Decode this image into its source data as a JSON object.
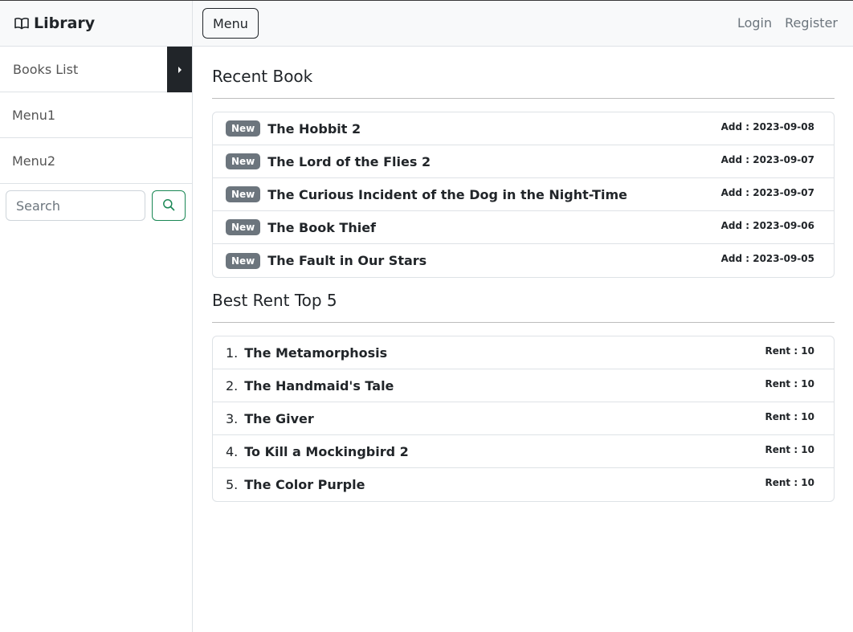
{
  "sidebar": {
    "brand": "Library",
    "brand_icon": "book-open-icon",
    "items": [
      {
        "label": "Books List"
      },
      {
        "label": "Menu1"
      },
      {
        "label": "Menu2"
      }
    ],
    "search": {
      "placeholder": "Search",
      "button_icon": "search-icon"
    }
  },
  "topbar": {
    "menu_label": "Menu",
    "login_label": "Login",
    "register_label": "Register"
  },
  "recent": {
    "title": "Recent Book",
    "badge": "New",
    "books": [
      {
        "title": "The Hobbit 2",
        "meta": "Add : 2023-09-08"
      },
      {
        "title": "The Lord of the Flies 2",
        "meta": "Add : 2023-09-07"
      },
      {
        "title": "The Curious Incident of the Dog in the Night-Time",
        "meta": "Add : 2023-09-07"
      },
      {
        "title": "The Book Thief",
        "meta": "Add : 2023-09-06"
      },
      {
        "title": "The Fault in Our Stars",
        "meta": "Add : 2023-09-05"
      }
    ]
  },
  "best": {
    "title": "Best Rent Top 5",
    "books": [
      {
        "rank": "1.",
        "title": "The Metamorphosis",
        "meta": "Rent : 10"
      },
      {
        "rank": "2.",
        "title": "The Handmaid's Tale",
        "meta": "Rent : 10"
      },
      {
        "rank": "3.",
        "title": "The Giver",
        "meta": "Rent : 10"
      },
      {
        "rank": "4.",
        "title": "To Kill a Mockingbird 2",
        "meta": "Rent : 10"
      },
      {
        "rank": "5.",
        "title": "The Color Purple",
        "meta": "Rent : 10"
      }
    ]
  },
  "colors": {
    "accent": "#198754",
    "dark": "#212529",
    "badge": "#6c757d"
  }
}
